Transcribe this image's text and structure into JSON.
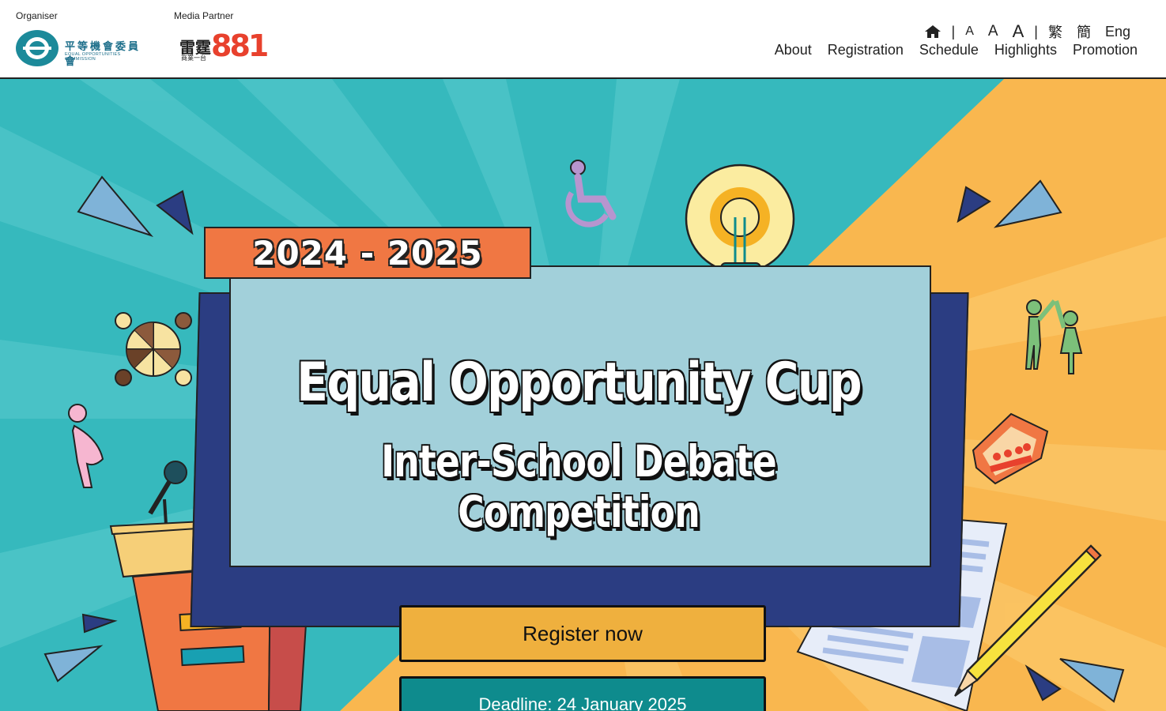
{
  "header": {
    "organiser_label": "Organiser",
    "media_partner_label": "Media Partner",
    "organiser_logo": {
      "name_cn": "平等機會委員會",
      "name_en": "EQUAL OPPORTUNITIES COMMISSION"
    },
    "media_partner_logo": {
      "name_cn": "雷霆",
      "tagline_cn": "商業一台",
      "number": "881"
    },
    "utility": {
      "home_icon": "home-icon",
      "font_sizes": [
        "A",
        "A",
        "A"
      ],
      "languages": [
        "繁",
        "簡",
        "Eng"
      ],
      "separator": "|"
    },
    "nav": [
      "About",
      "Registration",
      "Schedule",
      "Highlights",
      "Promotion"
    ]
  },
  "hero": {
    "year": "2024 - 2025",
    "title": "Equal Opportunity Cup",
    "subtitle": "Inter-School Debate Competition",
    "register_button": "Register now",
    "deadline": "Deadline: 24 January 2025",
    "colors": {
      "teal_bg": "#36b9bd",
      "orange_bg": "#f9b74f",
      "board": "#a2d0da",
      "board_back": "#2b3d82",
      "year_tag": "#f07743",
      "register_button": "#efb03e",
      "deadline_box": "#0e8b8d"
    },
    "decorations": [
      "wheelchair-icon",
      "lightbulb-gear-icon",
      "diverse-hands-circle-icon",
      "pregnant-woman-icon",
      "microphone-icon",
      "podium",
      "family-high-five-icon",
      "house-family-icon",
      "document-paper",
      "pencil-icon",
      "triangle-shapes"
    ]
  }
}
